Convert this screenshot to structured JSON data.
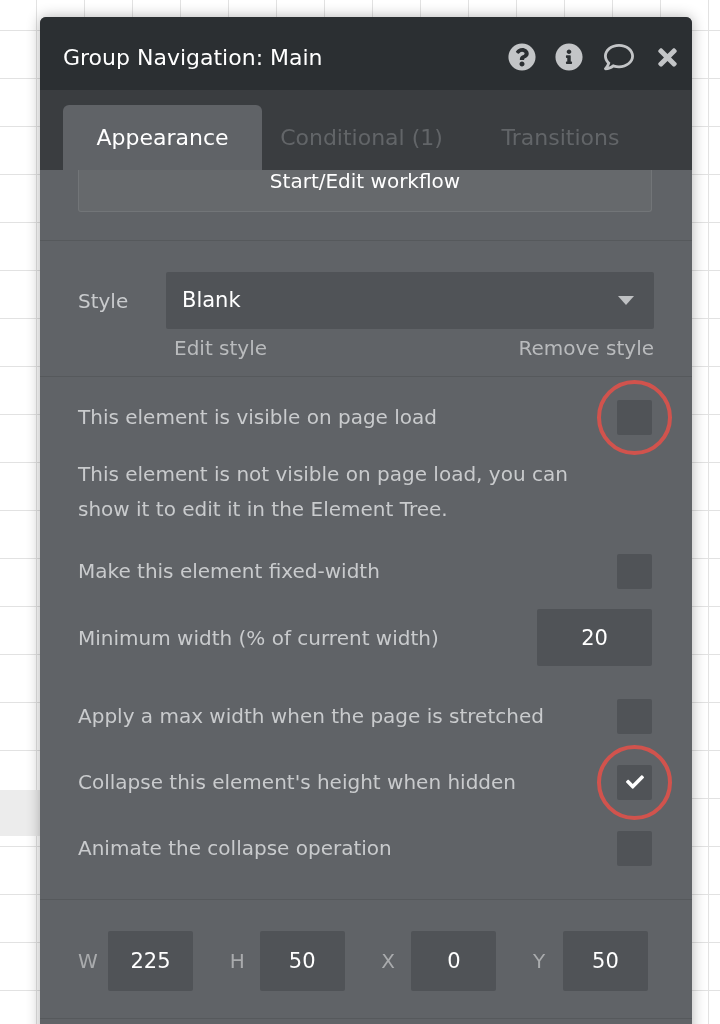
{
  "window": {
    "title": "Group Navigation: Main"
  },
  "tabs": [
    {
      "label": "Appearance",
      "selected": true
    },
    {
      "label": "Conditional (1)",
      "selected": false
    },
    {
      "label": "Transitions",
      "selected": false
    }
  ],
  "workflow_button": {
    "label": "Start/Edit workflow"
  },
  "style": {
    "label": "Style",
    "value": "Blank",
    "links": [
      "Edit style",
      "Remove style"
    ]
  },
  "options": [
    {
      "kind": "checkbox",
      "label": "This element is visible on page load",
      "checked": false,
      "highlighted": true
    },
    {
      "kind": "note",
      "text": "This element is not visible on page load, you can show it to edit it in the Element Tree."
    },
    {
      "kind": "checkbox",
      "label": "Make this element fixed-width",
      "checked": false,
      "highlighted": false
    },
    {
      "kind": "number",
      "label": "Minimum width (% of current width)",
      "value": "20"
    },
    {
      "kind": "checkbox",
      "label": "Apply a max width when the page is stretched",
      "checked": false,
      "highlighted": false
    },
    {
      "kind": "checkbox",
      "label": "Collapse this element's height when hidden",
      "checked": true,
      "highlighted": true
    },
    {
      "kind": "checkbox",
      "label": "Animate the collapse operation",
      "checked": false,
      "highlighted": false
    }
  ],
  "geometry": [
    {
      "label": "W",
      "value": "225"
    },
    {
      "label": "H",
      "value": "50"
    },
    {
      "label": "X",
      "value": "0"
    },
    {
      "label": "Y",
      "value": "50"
    }
  ]
}
